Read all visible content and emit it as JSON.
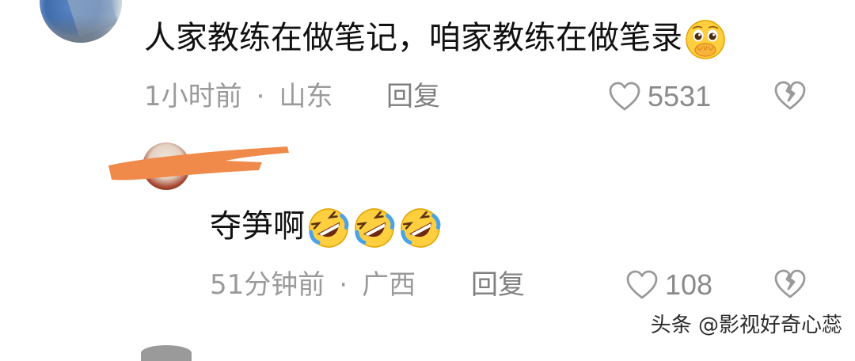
{
  "comment": {
    "text": "人家教练在做笔记，咱家教练在做笔录",
    "emoji": "hands-over-mouth-pleading-emoji",
    "time": "1小时前",
    "separator": "·",
    "location": "山东",
    "reply_label": "回复",
    "likes": "5531"
  },
  "reply": {
    "text": "夺笋啊",
    "emoji": [
      "rolling-laughing-emoji",
      "rolling-laughing-emoji",
      "rolling-laughing-emoji"
    ],
    "time": "51分钟前",
    "separator": "·",
    "location": "广西",
    "reply_label": "回复",
    "likes": "108",
    "username_redacted": true
  },
  "watermark": "头条 @影视好奇心蕊",
  "colors": {
    "meta_text": "#9a9a9a",
    "redaction": "#f08a4b",
    "emoji_yellow": "#ffcf3f"
  },
  "icons": [
    "heart-outline-icon",
    "broken-heart-icon"
  ]
}
